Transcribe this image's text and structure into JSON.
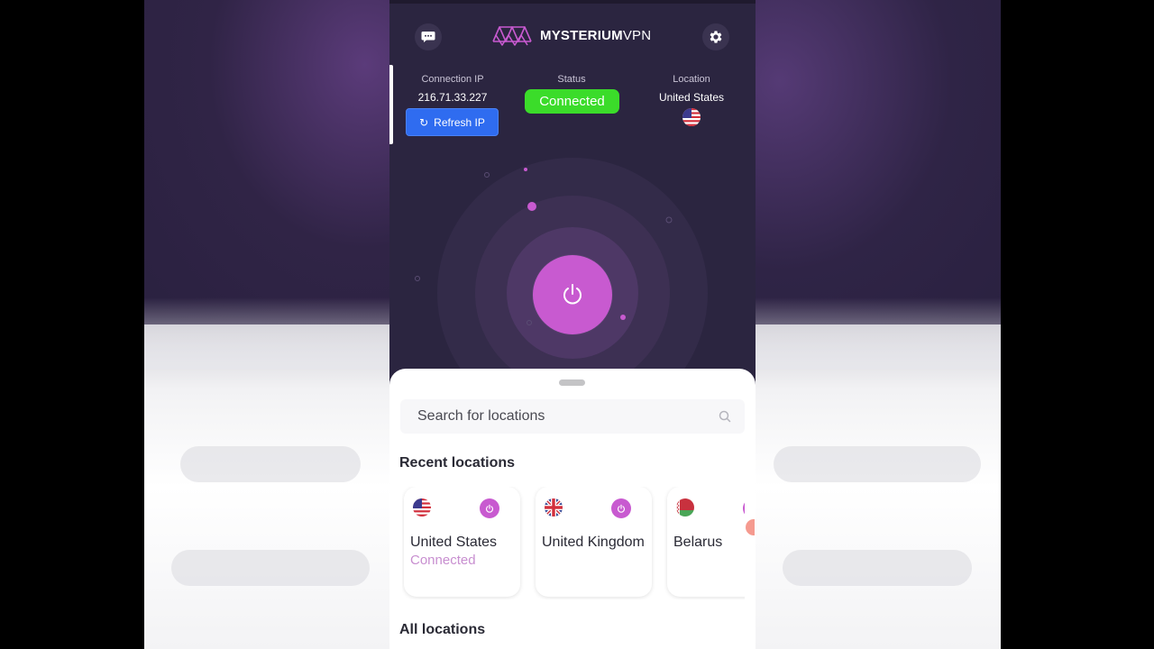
{
  "app": {
    "logo_bold": "MYSTERIUM",
    "logo_light": "VPN"
  },
  "header": {
    "chat_icon": "chat-bubble-icon",
    "settings_icon": "gear-icon"
  },
  "connection": {
    "ip_label": "Connection IP",
    "ip_value": "216.71.33.227",
    "refresh_label": "Refresh IP",
    "status_label": "Status",
    "status_value": "Connected",
    "location_label": "Location",
    "location_value": "United States"
  },
  "sheet": {
    "search_placeholder": "Search for locations",
    "recent_title": "Recent locations",
    "all_title": "All locations",
    "recent": [
      {
        "name": "United States",
        "status": "Connected",
        "flag": "us-flag-icon"
      },
      {
        "name": "United Kingdom",
        "status": "",
        "flag": "uk-flag-icon"
      },
      {
        "name": "Belarus",
        "status": "",
        "flag": "belarus-flag-icon"
      }
    ]
  },
  "colors": {
    "background": "#2b2540",
    "accent": "#c85ad0",
    "connected": "#3bdc2a",
    "refresh": "#2f6cf0"
  }
}
